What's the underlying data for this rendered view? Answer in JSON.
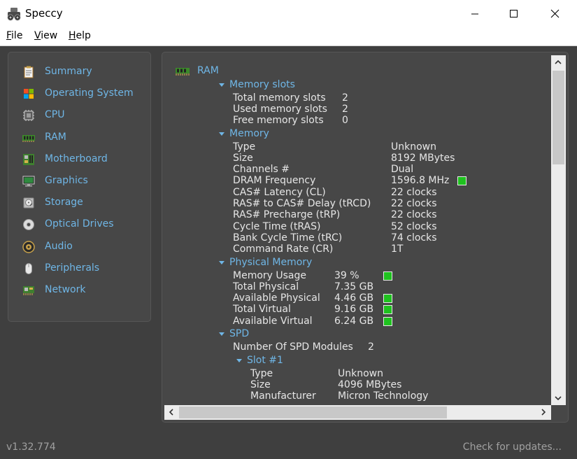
{
  "window": {
    "title": "Speccy",
    "icon": "speccy-icon",
    "controls": [
      "minimize-icon",
      "maximize-icon",
      "close-icon"
    ]
  },
  "menu": {
    "file": {
      "mnemonic": "F",
      "rest": "ile"
    },
    "view": {
      "mnemonic": "V",
      "rest": "iew"
    },
    "help": {
      "mnemonic": "H",
      "rest": "elp"
    }
  },
  "sidebar": {
    "items": [
      {
        "label": "Summary",
        "icon": "summary-icon"
      },
      {
        "label": "Operating System",
        "icon": "windows-logo-icon"
      },
      {
        "label": "CPU",
        "icon": "cpu-chip-icon"
      },
      {
        "label": "RAM",
        "icon": "ram-module-icon"
      },
      {
        "label": "Motherboard",
        "icon": "motherboard-icon"
      },
      {
        "label": "Graphics",
        "icon": "monitor-icon"
      },
      {
        "label": "Storage",
        "icon": "hard-drive-icon"
      },
      {
        "label": "Optical Drives",
        "icon": "optical-disc-icon"
      },
      {
        "label": "Audio",
        "icon": "speaker-icon"
      },
      {
        "label": "Peripherals",
        "icon": "mouse-icon"
      },
      {
        "label": "Network",
        "icon": "network-card-icon"
      }
    ]
  },
  "ram": {
    "title": "RAM",
    "memory_slots": {
      "heading": "Memory slots",
      "rows": [
        {
          "label": "Total memory slots",
          "value": "2"
        },
        {
          "label": "Used memory slots",
          "value": "2"
        },
        {
          "label": "Free memory slots",
          "value": "0"
        }
      ]
    },
    "memory": {
      "heading": "Memory",
      "rows": [
        {
          "label": "Type",
          "value": "Unknown"
        },
        {
          "label": "Size",
          "value": "8192 MBytes"
        },
        {
          "label": "Channels #",
          "value": "Dual"
        },
        {
          "label": "DRAM Frequency",
          "value": "1596.8 MHz"
        },
        {
          "label": "CAS# Latency (CL)",
          "value": "22 clocks"
        },
        {
          "label": "RAS# to CAS# Delay (tRCD)",
          "value": "22 clocks"
        },
        {
          "label": "RAS# Precharge (tRP)",
          "value": "22 clocks"
        },
        {
          "label": "Cycle Time (tRAS)",
          "value": "52 clocks"
        },
        {
          "label": "Bank Cycle Time (tRC)",
          "value": "74 clocks"
        },
        {
          "label": "Command Rate (CR)",
          "value": "1T"
        }
      ]
    },
    "physical_memory": {
      "heading": "Physical Memory",
      "rows": [
        {
          "label": "Memory Usage",
          "value": "39 %"
        },
        {
          "label": "Total Physical",
          "value": "7.35 GB"
        },
        {
          "label": "Available Physical",
          "value": "4.46 GB"
        },
        {
          "label": "Total Virtual",
          "value": "9.16 GB"
        },
        {
          "label": "Available Virtual",
          "value": "6.24 GB"
        }
      ]
    },
    "spd": {
      "heading": "SPD",
      "modules_label": "Number Of SPD Modules",
      "modules_value": "2",
      "slot": {
        "heading": "Slot #1",
        "rows": [
          {
            "label": "Type",
            "value": "Unknown"
          },
          {
            "label": "Size",
            "value": "4096 MBytes"
          },
          {
            "label": "Manufacturer",
            "value": "Micron Technology"
          }
        ]
      }
    }
  },
  "status": {
    "version": "v1.32.774",
    "check_updates": "Check for updates..."
  },
  "colors": {
    "background": "#3f3f3f",
    "panel": "#474747",
    "accent": "#6fb6e6",
    "text": "#e6e6e6",
    "gauge": "#1fc21f"
  }
}
